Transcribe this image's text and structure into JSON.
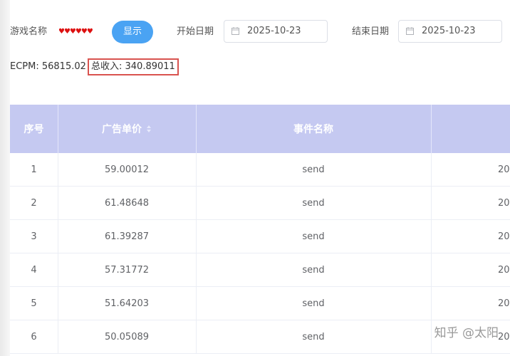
{
  "filters": {
    "game_name_label": "游戏名称",
    "game_name_value": "♥♥♥♥♥♥",
    "show_button": "显示",
    "start_date_label": "开始日期",
    "start_date_value": "2025-10-23",
    "end_date_label": "结束日期",
    "end_date_value": "2025-10-23"
  },
  "stats": {
    "ecpm": "ECPM: 56815.02",
    "total_revenue": "总收入: 340.89011"
  },
  "table": {
    "headers": [
      "序号",
      "广告单价",
      "事件名称",
      ""
    ],
    "rows": [
      {
        "index": "1",
        "price": "59.00012",
        "event": "send",
        "time": "20"
      },
      {
        "index": "2",
        "price": "61.48648",
        "event": "send",
        "time": "20"
      },
      {
        "index": "3",
        "price": "61.39287",
        "event": "send",
        "time": "20"
      },
      {
        "index": "4",
        "price": "57.31772",
        "event": "send",
        "time": "20"
      },
      {
        "index": "5",
        "price": "51.64203",
        "event": "send",
        "time": "20"
      },
      {
        "index": "6",
        "price": "50.05089",
        "event": "send",
        "time": "20"
      }
    ]
  },
  "watermark": "知乎 @太阳",
  "colors": {
    "header_bg": "#c5c9f1",
    "button_bg": "#4aa3f3",
    "highlight_border": "#d9534f"
  },
  "icons": [
    "calendar-icon",
    "sort-icon"
  ]
}
